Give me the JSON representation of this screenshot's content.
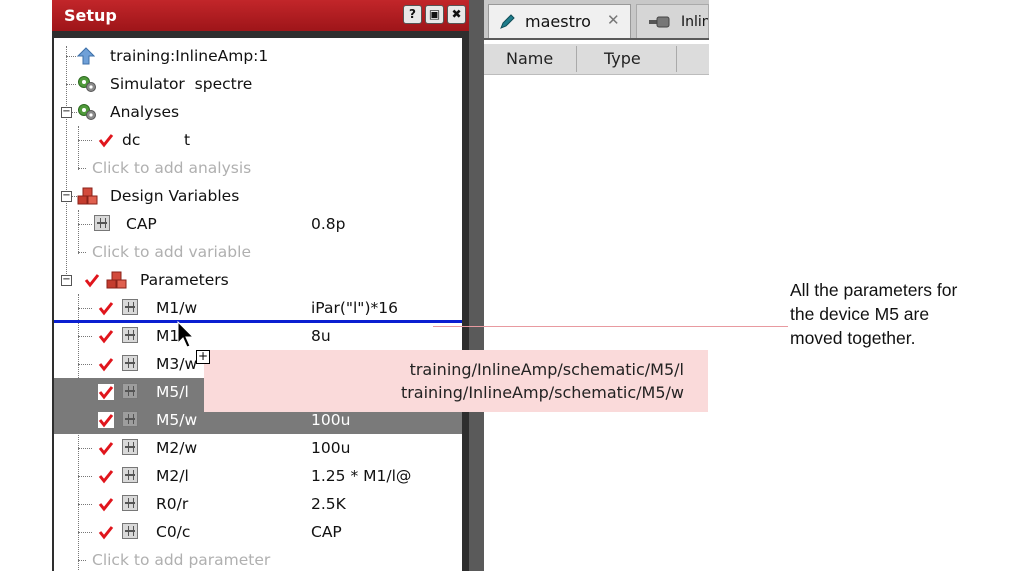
{
  "setup_panel": {
    "title": "Setup",
    "header_buttons": [
      "?",
      "▣",
      "✖"
    ]
  },
  "tree": {
    "project": "training:InlineAmp:1",
    "simulator": "Simulator  spectre",
    "analyses_label": "Analyses",
    "analysis_name": "dc",
    "analysis_value": "t",
    "add_analysis": "Click to add analysis",
    "design_variables_label": "Design Variables",
    "variable_name": "CAP",
    "variable_value": "0.8p",
    "add_variable": "Click to add variable",
    "parameters_label": "Parameters",
    "parameters": [
      {
        "name": "M1/w",
        "value": "iPar(\"l\")*16",
        "selected": false
      },
      {
        "name": "M1",
        "value": "8u",
        "selected": false
      },
      {
        "name": "M3/w",
        "value": "",
        "selected": false
      },
      {
        "name": "M5/l",
        "value": "",
        "selected": true
      },
      {
        "name": "M5/w",
        "value": "100u",
        "selected": true
      },
      {
        "name": "M2/w",
        "value": "100u",
        "selected": false
      },
      {
        "name": "M2/l",
        "value": "1.25 * M1/l@",
        "selected": false
      },
      {
        "name": "R0/r",
        "value": "2.5K",
        "selected": false
      },
      {
        "name": "C0/c",
        "value": "CAP",
        "selected": false
      }
    ],
    "add_parameter": "Click to add parameter"
  },
  "drag_tooltip": {
    "line1": "training/InlineAmp/schematic/M5/l",
    "line2": "training/InlineAmp/schematic/M5/w"
  },
  "tabs": [
    {
      "label": "maestro",
      "close": "✕"
    },
    {
      "label": "Inlin"
    }
  ],
  "columns": [
    "Name",
    "Type"
  ],
  "annotation": {
    "line1": "All the parameters for",
    "line2": "the device M5 are",
    "line3": "moved together."
  },
  "colors": {
    "header_red": "#b01e22",
    "checkmark_red": "#e0151c",
    "drop_line_blue": "#0a1fd1",
    "selected_row": "#7a7a7a",
    "tooltip_bg": "#fadada"
  }
}
